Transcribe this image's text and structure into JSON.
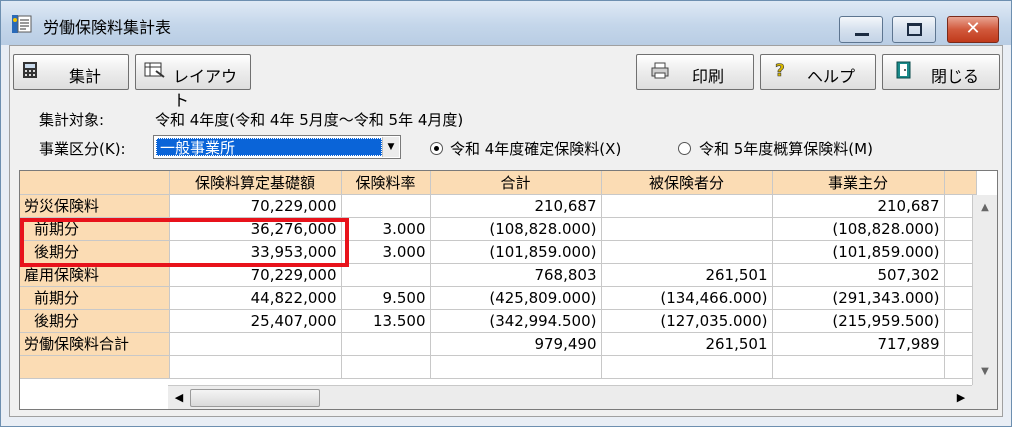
{
  "window": {
    "title": "労働保険料集計表"
  },
  "toolbar": {
    "shukei": "集計",
    "layout": "レイアウト",
    "print": "印刷",
    "help": "ヘルプ",
    "close": "閉じる"
  },
  "form": {
    "target_label": "集計対象:",
    "target_value": "令和 4年度(令和 4年 5月度～令和 5年 4月度)",
    "kubun_label": "事業区分(K):",
    "kubun_value": "一般事業所",
    "radio1_label": "令和 4年度確定保険料(X)",
    "radio2_label": "令和 5年度概算保険料(M)",
    "radio_selected": 1
  },
  "grid": {
    "headers": [
      "",
      "保険料算定基礎額",
      "保険料率",
      "合計",
      "被保険者分",
      "事業主分"
    ],
    "rows": [
      {
        "cat": "労災保険料",
        "sub": false,
        "base": "70,229,000",
        "rate": "",
        "total": "210,687",
        "insured": "",
        "employer": "210,687"
      },
      {
        "cat": "前期分",
        "sub": true,
        "base": "36,276,000",
        "rate": "3.000",
        "total": "(108,828.000)",
        "insured": "",
        "employer": "(108,828.000)"
      },
      {
        "cat": "後期分",
        "sub": true,
        "base": "33,953,000",
        "rate": "3.000",
        "total": "(101,859.000)",
        "insured": "",
        "employer": "(101,859.000)"
      },
      {
        "cat": "雇用保険料",
        "sub": false,
        "base": "70,229,000",
        "rate": "",
        "total": "768,803",
        "insured": "261,501",
        "employer": "507,302"
      },
      {
        "cat": "前期分",
        "sub": true,
        "base": "44,822,000",
        "rate": "9.500",
        "total": "(425,809.000)",
        "insured": "(134,466.000)",
        "employer": "(291,343.000)"
      },
      {
        "cat": "後期分",
        "sub": true,
        "base": "25,407,000",
        "rate": "13.500",
        "total": "(342,994.500)",
        "insured": "(127,035.000)",
        "employer": "(215,959.500)"
      },
      {
        "cat": "労働保険料合計",
        "sub": false,
        "base": "",
        "rate": "",
        "total": "979,490",
        "insured": "261,501",
        "employer": "717,989"
      }
    ]
  },
  "colors": {
    "header_bg": "#fbdcb4",
    "highlight": "#e8121b",
    "selection": "#0a64d8"
  }
}
